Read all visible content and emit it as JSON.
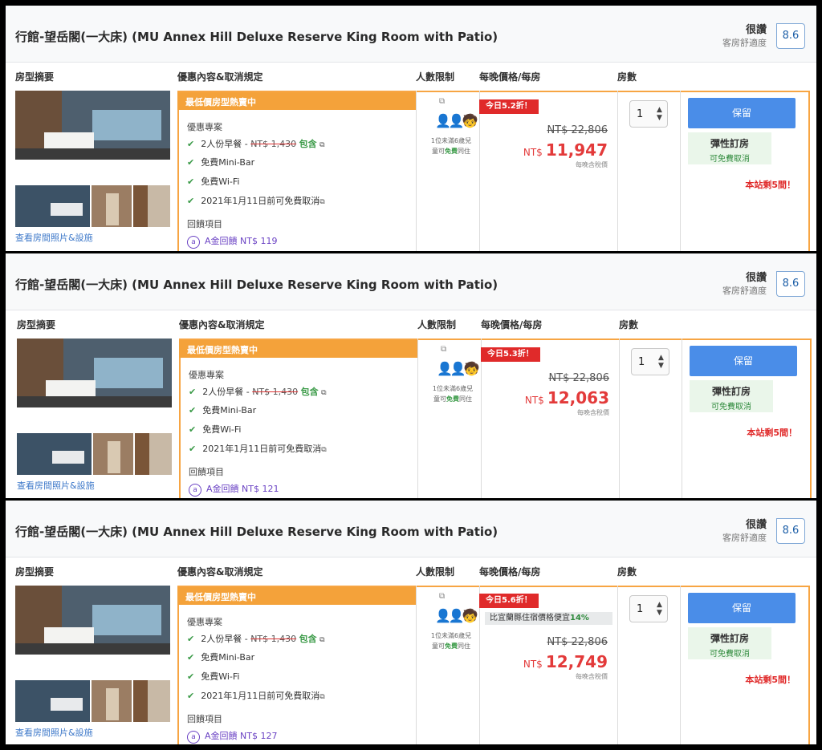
{
  "room": {
    "title": "行館-望岳閣(一大床) (MU Annex Hill Deluxe Reserve King Room with Patio)",
    "review_word": "很讚",
    "review_sub": "客房舒適度",
    "score": "8.6"
  },
  "columns": {
    "summary": "房型摘要",
    "deal": "優惠內容&取消規定",
    "occupancy": "人數限制",
    "price": "每晚價格/每房",
    "rooms": "房數"
  },
  "common": {
    "photos_link": "查看房間照片&設施",
    "bar": "最低價房型熱賣中",
    "deal_label": "優惠專案",
    "breakfast": "2人份早餐 - ",
    "breakfast_price": "NT$ 1,430",
    "breakfast_included": "包含",
    "minibar": "免費Mini-Bar",
    "wifi": "免費Wi-Fi",
    "cancel": "2021年1月11日前可免費取消",
    "rewards_label": "回饋項目",
    "occ_note_1": "1位未滿6歲兒",
    "occ_note_2": "童可",
    "occ_note_free": "免費",
    "occ_note_3": "同住",
    "orig_price": "NT$ 22,806",
    "currency": "NT$",
    "tax_note": "每晚含稅價",
    "qty": "1",
    "reserve": "保留",
    "flex_title": "彈性訂房",
    "flex_sub": "可免費取消",
    "left": "本站剩5間！"
  },
  "offers": [
    {
      "discount": "今日5.2折！",
      "price": "11,947",
      "reward": "A金回饋 NT$ 119"
    },
    {
      "discount": "今日5.3折！",
      "price": "12,063",
      "reward": "A金回饋 NT$ 121"
    },
    {
      "discount": "今日5.6折！",
      "compare_a": "比宜蘭縣住宿價格便宜",
      "compare_pct": "14%",
      "price": "12,749",
      "reward": "A金回饋 NT$ 127"
    }
  ],
  "icons": {
    "check": "checkmark-icon",
    "external": "external-link-icon",
    "people": "people-icon",
    "coin": "a-coin-icon",
    "stepper": "stepper-arrows-icon"
  }
}
